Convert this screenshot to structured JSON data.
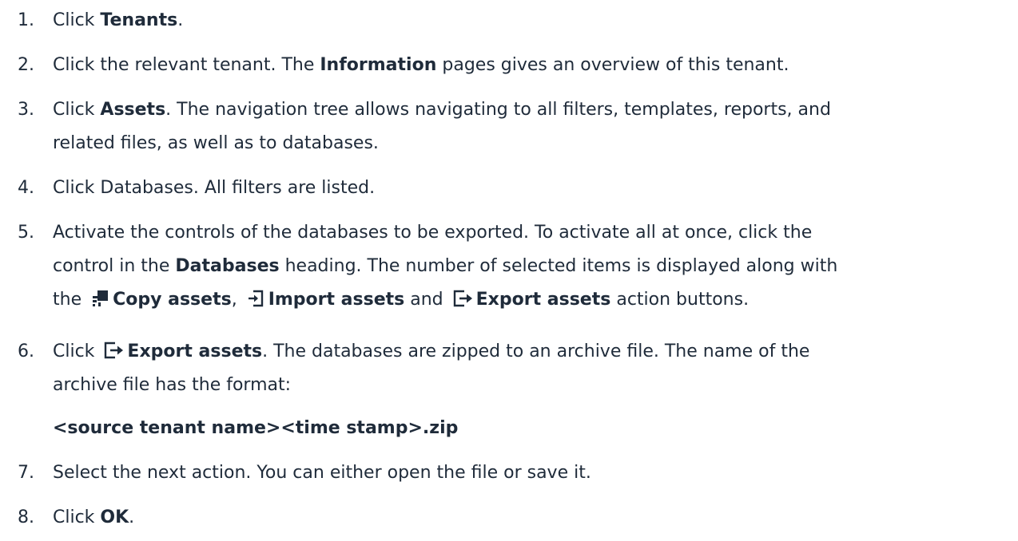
{
  "steps": [
    {
      "num": "1.",
      "pre": "Click ",
      "bold": "Tenants",
      "post": "."
    },
    {
      "num": "2.",
      "pre": "Click the relevant tenant. The ",
      "bold": "Information",
      "post": " pages gives an overview of this tenant."
    },
    {
      "num": "3.",
      "pre": "Click ",
      "bold": "Assets",
      "post": ". The navigation tree allows navigating to all filters, templates, reports, and",
      "line2": "related files, as well as to databases."
    },
    {
      "num": "4.",
      "text": "Click Databases. All filters are listed."
    },
    {
      "num": "5.",
      "line1": "Activate the controls of the databases to be exported. To activate all at once, click the",
      "line2_pre": "control in the ",
      "line2_bold": "Databases",
      "line2_post": " heading. The number of selected items is displayed along with",
      "line3_pre": "the ",
      "copy_label": "Copy assets",
      "sep1": ", ",
      "import_label": "Import assets",
      "sep2": " and ",
      "export_label": "Export assets",
      "line3_post": " action buttons."
    },
    {
      "num": "6.",
      "pre": "Click ",
      "export_label": "Export assets",
      "post": ". The databases are zipped to an archive file. The name of the",
      "line2": "archive file has the format:",
      "code": "<source tenant name><time stamp>.zip"
    },
    {
      "num": "7.",
      "text": "Select the next action. You can either open the file or save it."
    },
    {
      "num": "8.",
      "pre": "Click ",
      "bold": "OK",
      "post": "."
    }
  ]
}
